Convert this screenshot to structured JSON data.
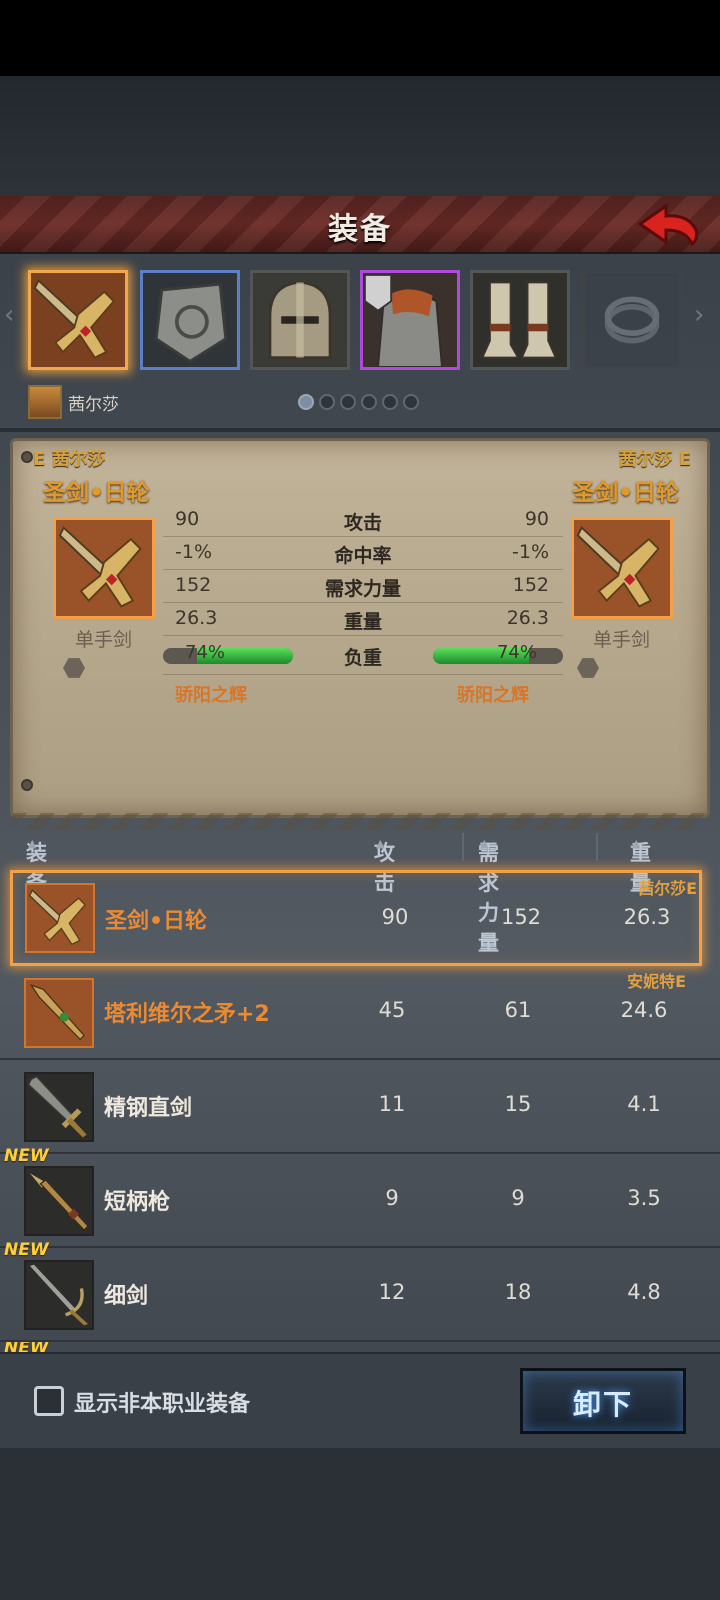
{
  "header": {
    "title": "装备"
  },
  "owner": {
    "name": "茜尔莎"
  },
  "compare": {
    "left": {
      "owner": "E 茜尔莎",
      "item_name": "圣剑•日轮",
      "type": "单手剑",
      "skill": "骄阳之辉",
      "attack": "90",
      "hit": "-1%",
      "strength": "152",
      "weight": "26.3",
      "load": "74%"
    },
    "right": {
      "owner": "茜尔莎 E",
      "item_name": "圣剑•日轮",
      "type": "单手剑",
      "skill": "骄阳之辉",
      "attack": "90",
      "hit": "-1%",
      "strength": "152",
      "weight": "26.3",
      "load": "74%"
    },
    "labels": {
      "attack": "攻击",
      "hit": "命中率",
      "strength": "需求力量",
      "weight": "重量",
      "load": "负重"
    },
    "load_fraction": 0.74
  },
  "list_header": {
    "filter": "装备筛选",
    "attack": "攻击",
    "strength": "需求力量",
    "weight": "重量"
  },
  "items": [
    {
      "name": "圣剑•日轮",
      "attack": "90",
      "strength": "152",
      "weight": "26.3",
      "owner": "茜尔莎E"
    },
    {
      "name": "塔利维尔之矛+2",
      "attack": "45",
      "strength": "61",
      "weight": "24.6",
      "owner": "安妮特E"
    },
    {
      "name": "精钢直剑",
      "attack": "11",
      "strength": "15",
      "weight": "4.1"
    },
    {
      "name": "短柄枪",
      "attack": "9",
      "strength": "9",
      "weight": "3.5",
      "badge": "NEW"
    },
    {
      "name": "细剑",
      "attack": "12",
      "strength": "18",
      "weight": "4.8",
      "badge": "NEW"
    }
  ],
  "partial_badge": "NEW",
  "footer": {
    "checkbox_label": "显示非本职业装备",
    "unequip": "卸下"
  },
  "colors": {
    "accent_orange": "#f2a04a",
    "header_red": "#6d2c26",
    "load_green": "#2fb83e",
    "button_glow": "#4aa0ff"
  }
}
